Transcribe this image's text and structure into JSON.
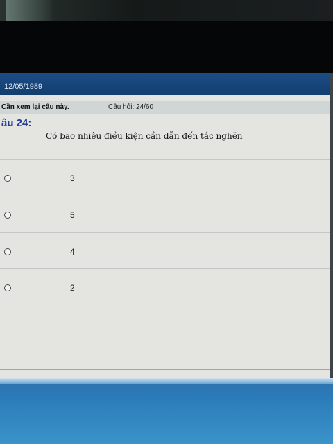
{
  "header": {
    "date": "12/05/1989"
  },
  "info_bar": {
    "review_label": "Cần xem lại câu này.",
    "question_counter": "Câu hỏi: 24/60"
  },
  "question": {
    "heading": "âu 24:",
    "text": "Có bao nhiêu điều kiện cần dẫn đến tắc nghẽn"
  },
  "options": [
    {
      "label": "3"
    },
    {
      "label": "5"
    },
    {
      "label": "4"
    },
    {
      "label": "2"
    }
  ],
  "colors": {
    "title_bar": "#1b4d86",
    "question_heading": "#1f3c9a",
    "taskbar": "#2a7cb9"
  }
}
